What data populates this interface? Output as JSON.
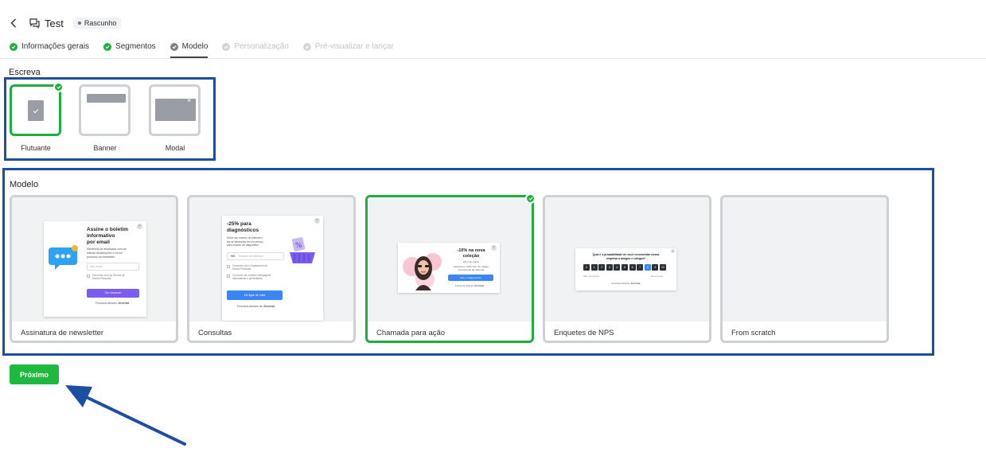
{
  "header": {
    "title": "Test",
    "badge": "Rascunho"
  },
  "steps": [
    {
      "label": "Informações gerais",
      "state": "done"
    },
    {
      "label": "Segmentos",
      "state": "done"
    },
    {
      "label": "Modelo",
      "state": "current"
    },
    {
      "label": "Personalização",
      "state": "disabled"
    },
    {
      "label": "Pré-visualizar e lançar",
      "state": "disabled"
    }
  ],
  "type_section": {
    "label": "Escreva",
    "items": [
      {
        "label": "Flutuante",
        "selected": true
      },
      {
        "label": "Banner",
        "selected": false
      },
      {
        "label": "Modal",
        "selected": false
      }
    ]
  },
  "template_section": {
    "label": "Modelo",
    "items": [
      {
        "label": "Assinatura de newsletter",
        "selected": false
      },
      {
        "label": "Consultas",
        "selected": false
      },
      {
        "label": "Chamada para ação",
        "selected": true
      },
      {
        "label": "Enquetes de NPS",
        "selected": false
      },
      {
        "label": "From scratch",
        "selected": false
      }
    ]
  },
  "previews": {
    "newsletter": {
      "title_line1": "Assine o boletim",
      "title_line2": "informativo",
      "title_line3": "por email",
      "body_line1": "Mantenha-se atualizado com as",
      "body_line2": "últimas atualizações e novos",
      "body_line3": "produtos da newsletter.",
      "input_placeholder": "Seu email",
      "consent_line1": "Concordo com os Termos de",
      "consent_line2": "Dados Pessoais",
      "button": "Ger inscrever",
      "footer_prefix": "Funciona através",
      "footer_brand": "Jivochat"
    },
    "consultas": {
      "title_line1": "-25% para",
      "title_line2": "diagnósticos",
      "body_line1": "Deixe seu número de telefone e",
      "body_line2": "faz-se descontos em um serviço",
      "body_line3": "para realizar um diagnóstico",
      "phone_code": "+55",
      "phone_placeholder": "Número de telefone",
      "check1_line1": "Concordo com o tratamento de",
      "check1_line2": "Dados Pessoais",
      "check2_line1": "Concordo em receber mensagens",
      "check2_line2": "informativas e publicitárias",
      "button": "Me ligue de volta",
      "footer_prefix": "Funciona através de",
      "footer_brand": "Jivochat"
    },
    "cta": {
      "title_line1": "-10% na nova",
      "title_line2": "coleção",
      "subtitle": "Até 1 de março",
      "body_line1": "Receba um 10% com um código",
      "body_line2": "promocional de toda loja",
      "button": "Use o código promo",
      "footer_prefix": "Funciona através",
      "footer_brand": "Jivochat"
    },
    "nps": {
      "question_line1": "Qual é a probabilidade de você recomendar nossa",
      "question_line2": "empresa a amigos e colegas?",
      "scale": [
        "0",
        "1",
        "2",
        "3",
        "4",
        "5",
        "6",
        "7",
        "8",
        "9",
        "10"
      ],
      "selected_index": 8,
      "left_hint": "Não recomendo",
      "right_hint": "Recomendo",
      "footer_prefix": "Funciona através",
      "footer_brand": "Jivochat"
    }
  },
  "next_button": "Próximo",
  "colors": {
    "accent_green": "#1fad3e",
    "highlight_blue": "#1c4ea1",
    "button_purple": "#7a5cf0",
    "button_blue": "#3a86f7"
  }
}
